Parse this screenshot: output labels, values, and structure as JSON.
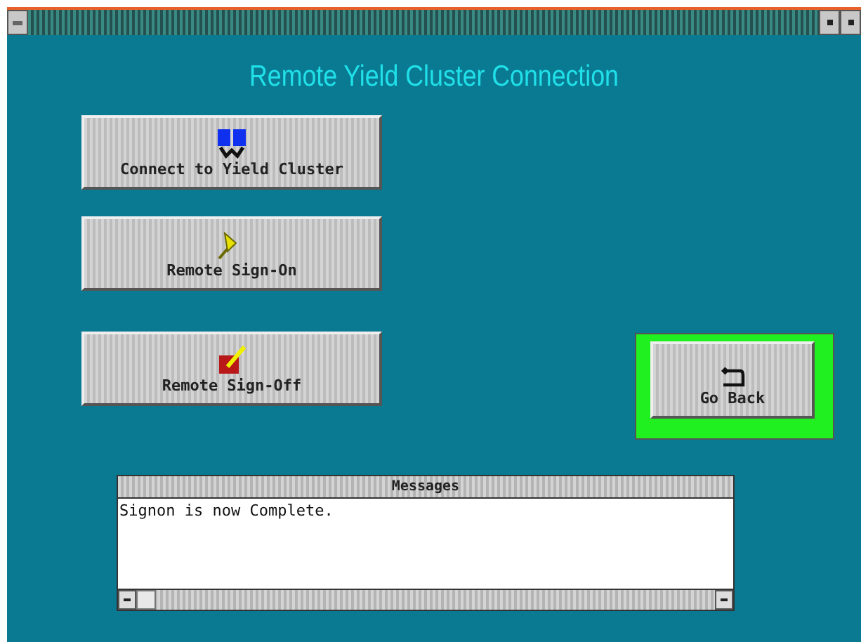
{
  "window": {
    "title": "Remote Yield Cluster Connection"
  },
  "buttons": [
    {
      "kind": "connect",
      "label": "Connect to Yield Cluster"
    },
    {
      "kind": "signon",
      "label": "Remote Sign-On"
    },
    {
      "kind": "signoff",
      "label": "Remote Sign-Off"
    }
  ],
  "go_back": {
    "label": "Go Back",
    "focused": true
  },
  "messages": {
    "title": "Messages",
    "lines": [
      "Signon is now Complete."
    ]
  }
}
